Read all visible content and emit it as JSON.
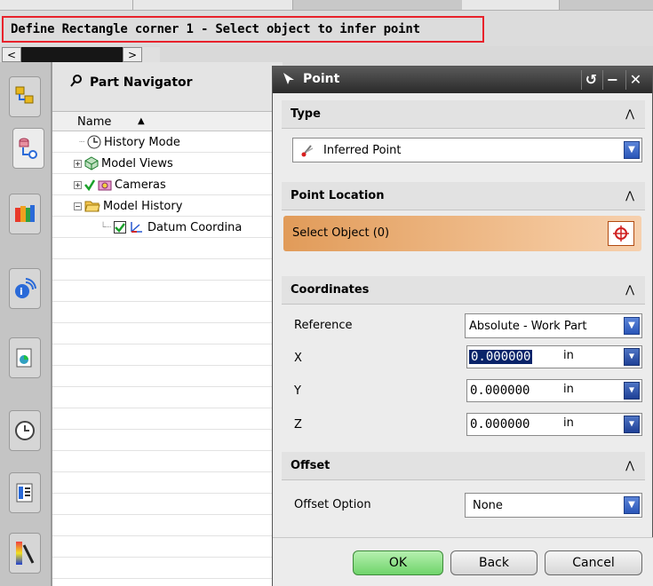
{
  "cue_line": "Define Rectangle corner 1 - Select object to infer point",
  "scroller": {
    "left_arrow": "<",
    "right_arrow": ">"
  },
  "navigator": {
    "title": "Part Navigator",
    "column_header": "Name",
    "items": [
      {
        "label": "History Mode"
      },
      {
        "label": "Model Views"
      },
      {
        "label": "Cameras"
      },
      {
        "label": "Model History"
      },
      {
        "label": "Datum Coordina"
      }
    ]
  },
  "dialog": {
    "title": "Point",
    "title_buttons": {
      "reset": "↺",
      "minimize": "−",
      "close": "✕"
    },
    "type_section": {
      "header": "Type",
      "value": "Inferred Point"
    },
    "location_section": {
      "header": "Point Location",
      "select_label": "Select Object (0)"
    },
    "coordinates_section": {
      "header": "Coordinates",
      "reference_label": "Reference",
      "reference_value": "Absolute - Work Part",
      "x_label": "X",
      "x_value": "0.000000",
      "x_unit": "in",
      "y_label": "Y",
      "y_value": "0.000000",
      "y_unit": "in",
      "z_label": "Z",
      "z_value": "0.000000",
      "z_unit": "in"
    },
    "offset_section": {
      "header": "Offset",
      "option_label": "Offset Option",
      "option_value": "None"
    },
    "buttons": {
      "ok": "OK",
      "back": "Back",
      "cancel": "Cancel"
    }
  },
  "colors": {
    "highlight_border": "#e8222b",
    "select_gradient": "#e19b59",
    "ok_green": "#6fd46a",
    "dropdown_blue": "#2a56b8"
  }
}
